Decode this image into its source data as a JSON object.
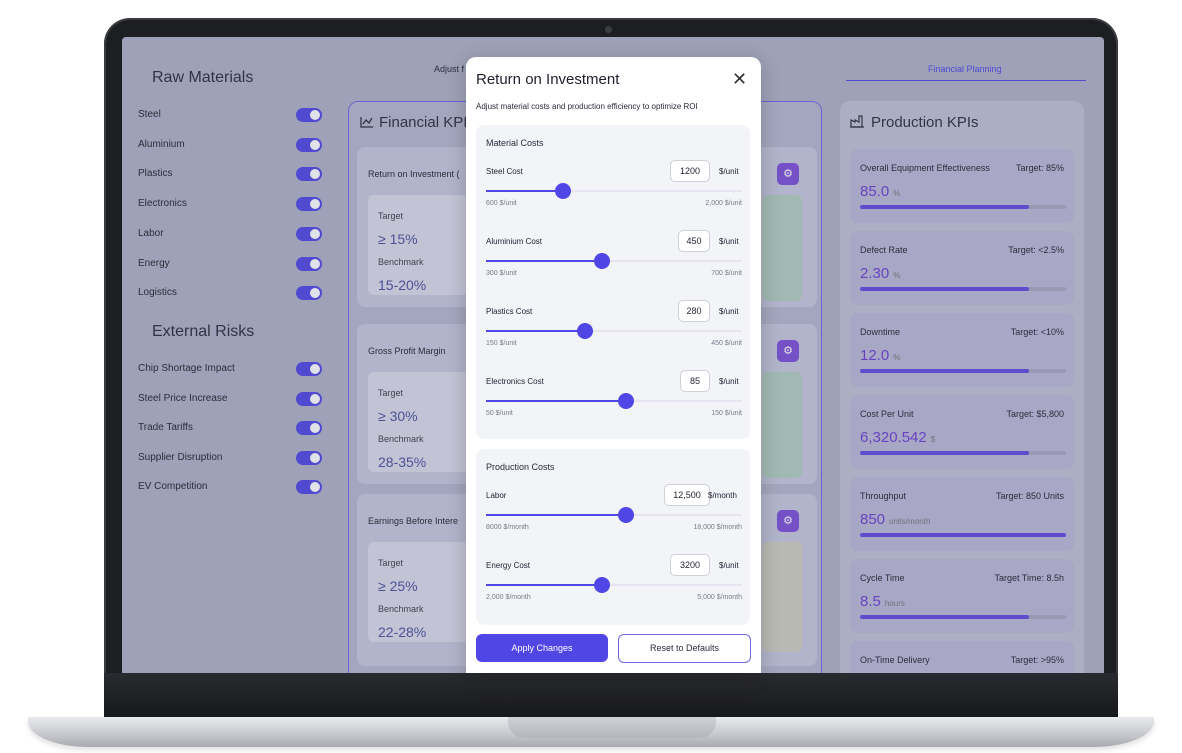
{
  "sidebar": {
    "raw_title": "Raw Materials",
    "raw_items": [
      {
        "label": "Steel",
        "on": true
      },
      {
        "label": "Aluminium",
        "on": true
      },
      {
        "label": "Plastics",
        "on": true
      },
      {
        "label": "Electronics",
        "on": true
      },
      {
        "label": "Labor",
        "on": true
      },
      {
        "label": "Energy",
        "on": true
      },
      {
        "label": "Logistics",
        "on": true
      }
    ],
    "risk_title": "External Risks",
    "risk_items": [
      {
        "label": "Chip Shortage Impact",
        "on": true
      },
      {
        "label": "Steel Price Increase",
        "on": true
      },
      {
        "label": "Trade Tariffs",
        "on": true
      },
      {
        "label": "Supplier Disruption",
        "on": true
      },
      {
        "label": "EV Competition",
        "on": true
      }
    ]
  },
  "topbar": {
    "adjust_text": "Adjust f",
    "tab_financial": "Financial Planning"
  },
  "financial": {
    "title": "Financial KPIs",
    "cards": [
      {
        "title": "Return on Investment (",
        "target_label": "Target",
        "target": "≥ 15%",
        "bench_label": "Benchmark",
        "bench": "15-20%"
      },
      {
        "title": "Gross Profit Margin",
        "target_label": "Target",
        "target": "≥ 30%",
        "bench_label": "Benchmark",
        "bench": "28-35%"
      },
      {
        "title": "Earnings Before Intere",
        "target_label": "Target",
        "target": "≥ 25%",
        "bench_label": "Benchmark",
        "bench": "22-28%"
      }
    ]
  },
  "production": {
    "title": "Production KPIs",
    "kpis": [
      {
        "name": "Overall Equipment Effectiveness",
        "target": "Target: 85%",
        "value": "85.0",
        "unit": "%",
        "progress": 0.82
      },
      {
        "name": "Defect Rate",
        "target": "Target: <2.5%",
        "value": "2.30",
        "unit": "%",
        "progress": 0.82
      },
      {
        "name": "Downtime",
        "target": "Target: <10%",
        "value": "12.0",
        "unit": "%",
        "progress": 0.82
      },
      {
        "name": "Cost Per Unit",
        "target": "Target: $5,800",
        "value": "6,320.542",
        "unit": "$",
        "progress": 0.82
      },
      {
        "name": "Throughput",
        "target": "Target: 850 Units",
        "value": "850",
        "unit": "units/month",
        "progress": 1.0
      },
      {
        "name": "Cycle Time",
        "target": "Target Time: 8.5h",
        "value": "8.5",
        "unit": "hours",
        "progress": 0.82
      },
      {
        "name": "On-Time Delivery",
        "target": "Target: >95%",
        "value": "",
        "unit": "",
        "progress": 0
      }
    ]
  },
  "modal": {
    "title": "Return on Investment",
    "subtitle": "Adjust material costs and production efficiency to optimize ROI",
    "material_title": "Material Costs",
    "materials": [
      {
        "label": "Steel Cost",
        "value": "1200",
        "unit": "$/unit",
        "min": "600 $/unit",
        "max": "2,000 $/unit",
        "fraction": 0.3
      },
      {
        "label": "Aluminium Cost",
        "value": "450",
        "unit": "$/unit",
        "min": "300 $/unit",
        "max": "700 $/unit",
        "fraction": 0.455
      },
      {
        "label": "Plastics Cost",
        "value": "280",
        "unit": "$/unit",
        "min": "150 $/unit",
        "max": "450 $/unit",
        "fraction": 0.385
      },
      {
        "label": "Electronics Cost",
        "value": "85",
        "unit": "$/unit",
        "min": "50 $/unit",
        "max": "150 $/unit",
        "fraction": 0.545
      }
    ],
    "production_title": "Production Costs",
    "production": [
      {
        "label": "Labor",
        "value": "12,500",
        "unit": "$/month",
        "min": "8000 $/month",
        "max": "18,000 $/month",
        "fraction": 0.545
      },
      {
        "label": "Energy Cost",
        "value": "3200",
        "unit": "$/unit",
        "min": "2,000 $/month",
        "max": "5,000 $/month",
        "fraction": 0.455
      }
    ],
    "apply_label": "Apply Changes",
    "reset_label": "Reset to Defaults"
  },
  "colors": {
    "accent": "#4f46e5",
    "kpi_value": "#6c3fd0",
    "slider_button": "#7c4dd8"
  },
  "icons": {
    "close": "close-icon",
    "financial": "chart-line-icon",
    "production": "factory-icon",
    "adjust": "sliders-icon"
  }
}
